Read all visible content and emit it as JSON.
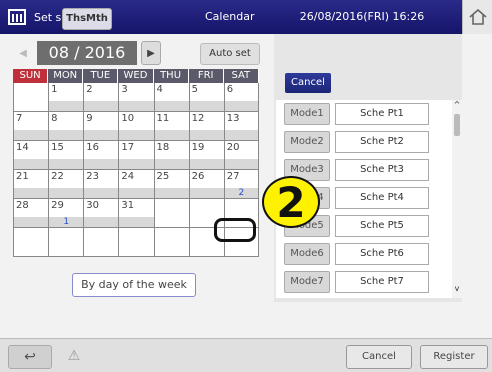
{
  "header": {
    "title": "Set schedule",
    "section": "Calendar",
    "datetime": "26/08/2016(FRI) 16:26"
  },
  "calendar": {
    "view_toggle": "ThsMth",
    "month": "08 / 2016",
    "auto_set": "Auto set",
    "weekdays": [
      "SUN",
      "MON",
      "TUE",
      "WED",
      "THU",
      "FRI",
      "SAT"
    ],
    "weeks": [
      [
        {
          "day": "",
          "pattern": ""
        },
        {
          "day": "1",
          "pattern": ""
        },
        {
          "day": "2",
          "pattern": ""
        },
        {
          "day": "3",
          "pattern": ""
        },
        {
          "day": "4",
          "pattern": ""
        },
        {
          "day": "5",
          "pattern": ""
        },
        {
          "day": "6",
          "pattern": ""
        }
      ],
      [
        {
          "day": "7",
          "pattern": ""
        },
        {
          "day": "8",
          "pattern": ""
        },
        {
          "day": "9",
          "pattern": ""
        },
        {
          "day": "10",
          "pattern": ""
        },
        {
          "day": "11",
          "pattern": ""
        },
        {
          "day": "12",
          "pattern": ""
        },
        {
          "day": "13",
          "pattern": ""
        }
      ],
      [
        {
          "day": "14",
          "pattern": ""
        },
        {
          "day": "15",
          "pattern": ""
        },
        {
          "day": "16",
          "pattern": ""
        },
        {
          "day": "17",
          "pattern": ""
        },
        {
          "day": "18",
          "pattern": ""
        },
        {
          "day": "19",
          "pattern": ""
        },
        {
          "day": "20",
          "pattern": ""
        }
      ],
      [
        {
          "day": "21",
          "pattern": ""
        },
        {
          "day": "22",
          "pattern": ""
        },
        {
          "day": "23",
          "pattern": ""
        },
        {
          "day": "24",
          "pattern": ""
        },
        {
          "day": "25",
          "pattern": ""
        },
        {
          "day": "26",
          "pattern": ""
        },
        {
          "day": "27",
          "pattern": "2"
        }
      ],
      [
        {
          "day": "28",
          "pattern": ""
        },
        {
          "day": "29",
          "pattern": "1"
        },
        {
          "day": "30",
          "pattern": ""
        },
        {
          "day": "31",
          "pattern": ""
        },
        {
          "day": "",
          "pattern": ""
        },
        {
          "day": "",
          "pattern": ""
        },
        {
          "day": "",
          "pattern": ""
        }
      ],
      [
        {
          "day": "",
          "pattern": ""
        },
        {
          "day": "",
          "pattern": ""
        },
        {
          "day": "",
          "pattern": ""
        },
        {
          "day": "",
          "pattern": ""
        },
        {
          "day": "",
          "pattern": ""
        },
        {
          "day": "",
          "pattern": ""
        },
        {
          "day": "",
          "pattern": ""
        }
      ]
    ],
    "by_day_button": "By day of the week"
  },
  "modes": {
    "cancel_label": "Cancel",
    "items": [
      {
        "mode": "Mode1",
        "pattern": "Sche Pt1"
      },
      {
        "mode": "Mode2",
        "pattern": "Sche Pt2"
      },
      {
        "mode": "Mode3",
        "pattern": "Sche Pt3"
      },
      {
        "mode": "Mode4",
        "pattern": "Sche Pt4"
      },
      {
        "mode": "Mode5",
        "pattern": "Sche Pt5"
      },
      {
        "mode": "Mode6",
        "pattern": "Sche Pt6"
      },
      {
        "mode": "Mode7",
        "pattern": "Sche Pt7"
      }
    ]
  },
  "callout": {
    "number": "2"
  },
  "footer": {
    "back_icon": "↩",
    "warning_icon": "⚠",
    "cancel": "Cancel",
    "register": "Register"
  }
}
